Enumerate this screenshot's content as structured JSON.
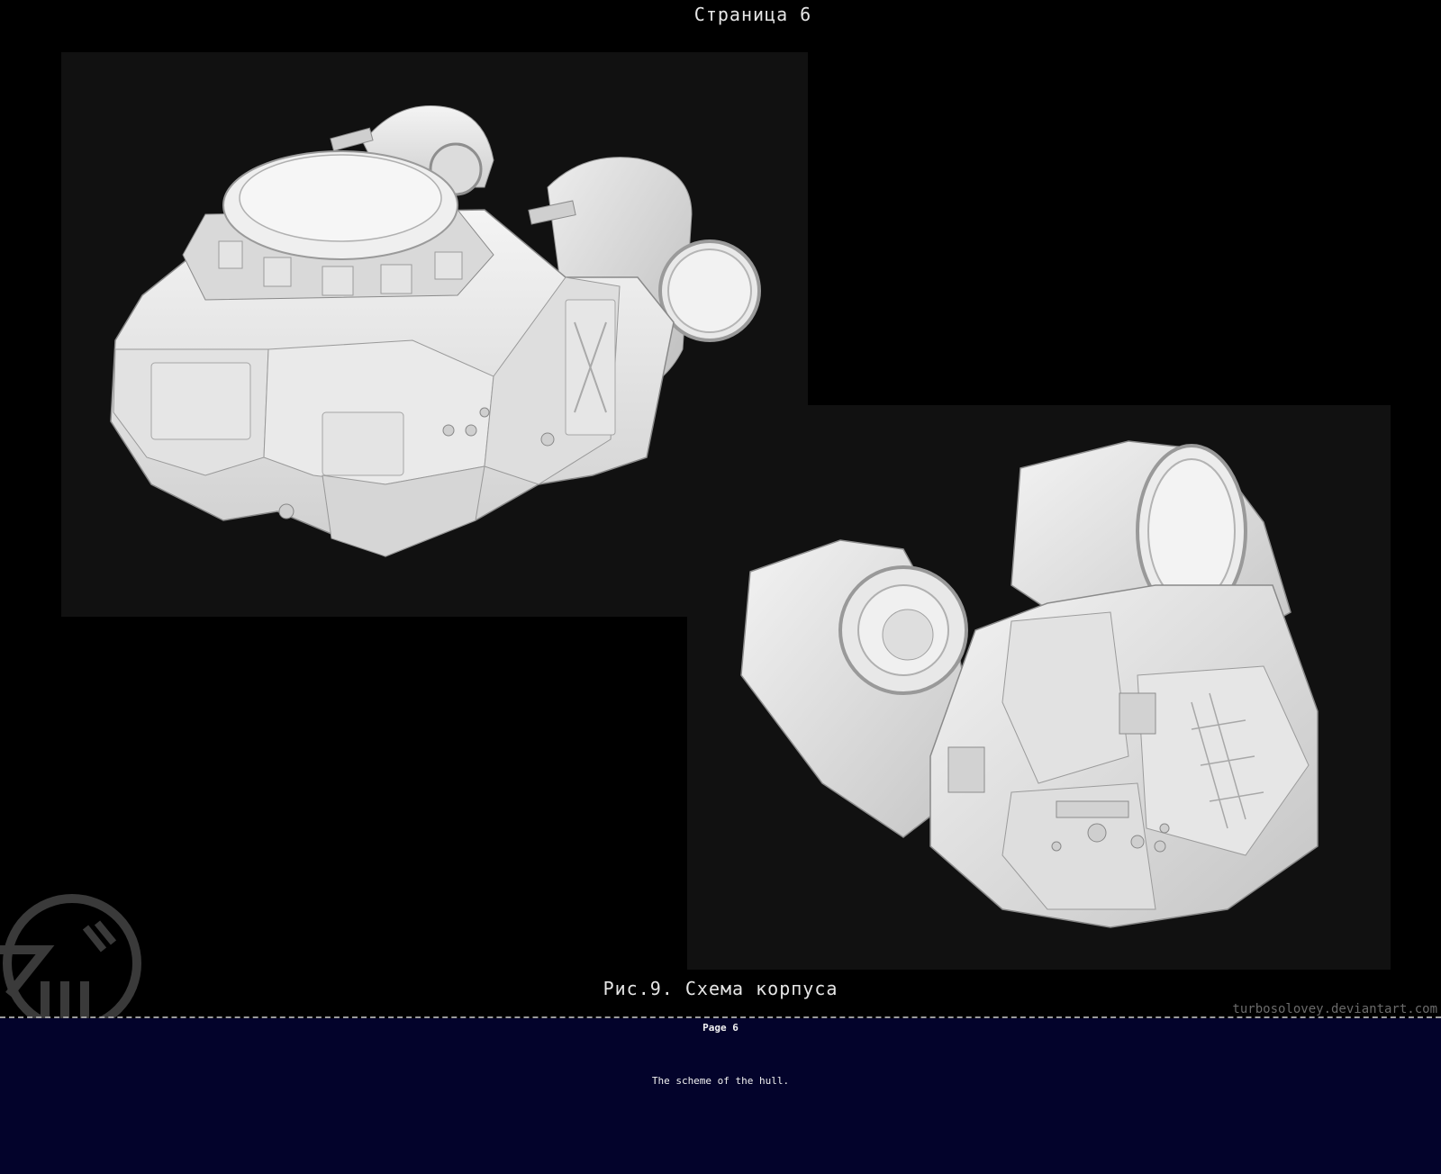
{
  "header": {
    "title": "Страница 6"
  },
  "figure": {
    "caption": "Рис.9. Схема корпуса",
    "images": [
      {
        "name": "hull-render-top",
        "subject": "3D hull model, front three-quarter view"
      },
      {
        "name": "hull-render-bottom",
        "subject": "3D hull model, underside view"
      }
    ]
  },
  "credit": {
    "site": "turbosolovey.deviantart.com"
  },
  "footer": {
    "page_label": "Page 6",
    "caption": "The scheme of the hull."
  },
  "colors": {
    "background": "#000000",
    "panel": "#111111",
    "footer_band": "#03032b",
    "model": "#e8e8e8",
    "text": "#e6e6e6"
  }
}
